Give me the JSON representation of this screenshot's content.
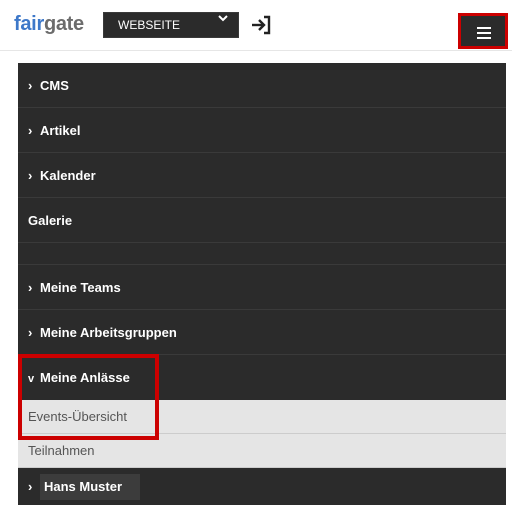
{
  "header": {
    "logo_part1": "fair",
    "logo_part2": "gate",
    "site_select": "WEBSEITE",
    "login_icon": "sign-in-icon",
    "menu_icon": "hamburger-menu-icon"
  },
  "menu": {
    "items": [
      {
        "label": "CMS",
        "expandable": true
      },
      {
        "label": "Artikel",
        "expandable": true
      },
      {
        "label": "Kalender",
        "expandable": true
      },
      {
        "label": "Galerie",
        "expandable": false
      },
      {
        "label": "Meine Teams",
        "expandable": true
      },
      {
        "label": "Meine Arbeitsgruppen",
        "expandable": true
      },
      {
        "label": "Meine Anlässe",
        "expandable": true,
        "expanded": true
      }
    ],
    "subitems": [
      {
        "label": "Events-Übersicht"
      },
      {
        "label": "Teilnahmen"
      }
    ],
    "user": {
      "label": "Hans Muster"
    }
  },
  "colors": {
    "highlight": "#cc0000",
    "menu_bg": "#2b2b2b",
    "submenu_bg": "#e5e5e5",
    "logo_blue": "#3d78c9"
  }
}
